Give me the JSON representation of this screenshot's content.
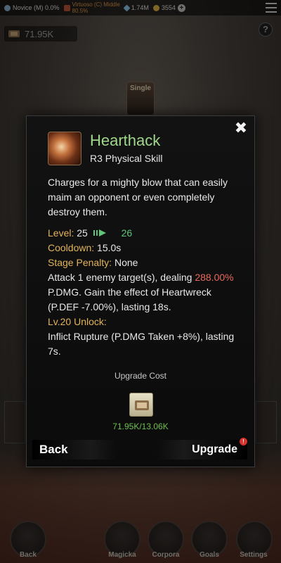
{
  "topbar": {
    "rank1": "Novice (M) 0.0%",
    "rank2": "Virtuoso (C) Middle",
    "rank2_pct": "80.5%",
    "power": "1.74M",
    "coins": "3554",
    "colors": {
      "novice": "#8fb6d8",
      "virtuoso": "#c0573a",
      "gem": "#8fd0f0",
      "coin": "#e6b94a"
    }
  },
  "currency": {
    "amount": "71.95K"
  },
  "single_tag": "Single",
  "modal": {
    "skill_name": "Hearthack",
    "skill_type": "R3 Physical Skill",
    "description": "Charges for a mighty blow that can easily maim an opponent or even completely destroy them.",
    "level_label": "Level:",
    "level_current": "25",
    "level_next": "26",
    "cooldown_label": "Cooldown:",
    "cooldown_value": "15.0s",
    "penalty_label": "Stage Penalty:",
    "penalty_value": "None",
    "effect_a": "Attack 1 enemy target(s), dealing ",
    "effect_pct": "288.00%",
    "effect_b": " P.DMG. Gain the effect of Heartwreck (P.DEF -7.00%), lasting 18s.",
    "unlock_label": "Lv.20 Unlock:",
    "unlock_text": "Inflict Rupture (P.DMG Taken +8%), lasting 7s.",
    "upgrade_cost_title": "Upgrade Cost",
    "cost_value": "71.95K/13.06K",
    "back_label": "Back",
    "upgrade_label": "Upgrade",
    "upgrade_badge": "!"
  },
  "bottomnav": {
    "items": [
      {
        "label": "Back"
      },
      {
        "label": "Magicka"
      },
      {
        "label": "Corpora"
      },
      {
        "label": "Goals"
      },
      {
        "label": "Settings"
      }
    ]
  }
}
